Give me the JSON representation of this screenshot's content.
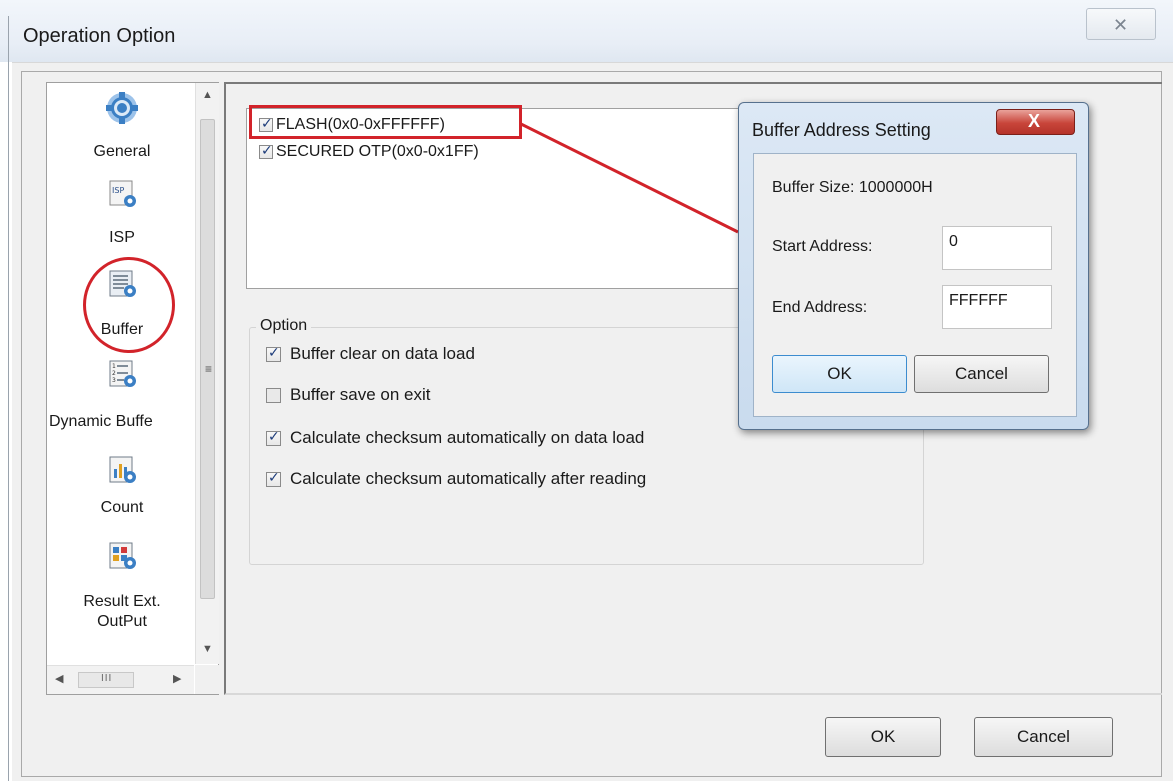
{
  "window": {
    "title": "Operation Option",
    "close_glyph": "✕"
  },
  "nav": {
    "items": [
      {
        "label": "General",
        "icon": "gear-icon"
      },
      {
        "label": "ISP",
        "icon": "isp-icon"
      },
      {
        "label": "Buffer",
        "icon": "buffer-icon"
      },
      {
        "label": "Dynamic Buffe",
        "icon": "dynamic-buffer-icon"
      },
      {
        "label": "Count",
        "icon": "count-chart-icon"
      },
      {
        "label": "Result Ext.",
        "label2": "OutPut",
        "icon": "result-output-icon"
      }
    ],
    "scroll_grip": "≡",
    "hscroll_grip": "III"
  },
  "buffer_list": {
    "items": [
      {
        "label": "FLASH(0x0-0xFFFFFF)",
        "checked": true
      },
      {
        "label": "SECURED OTP(0x0-0x1FF)",
        "checked": true
      }
    ]
  },
  "options": {
    "legend": "Option",
    "items": [
      {
        "label": "Buffer clear on data load",
        "checked": true
      },
      {
        "label": "Buffer save on exit",
        "checked": false
      },
      {
        "label": "Calculate checksum automatically on data load",
        "checked": true
      },
      {
        "label": "Calculate checksum automatically after reading",
        "checked": true
      }
    ]
  },
  "buttons": {
    "ok": "OK",
    "cancel": "Cancel"
  },
  "dialog": {
    "title": "Buffer Address Setting",
    "close_glyph": "X",
    "buffer_size": "Buffer Size: 1000000H",
    "start_label": "Start Address:",
    "start_value": "0",
    "end_label": "End Address:",
    "end_value": "FFFFFF",
    "ok": "OK",
    "cancel": "Cancel"
  },
  "colors": {
    "annotation": "#d2232a",
    "gear_blue": "#3b7fc4"
  }
}
